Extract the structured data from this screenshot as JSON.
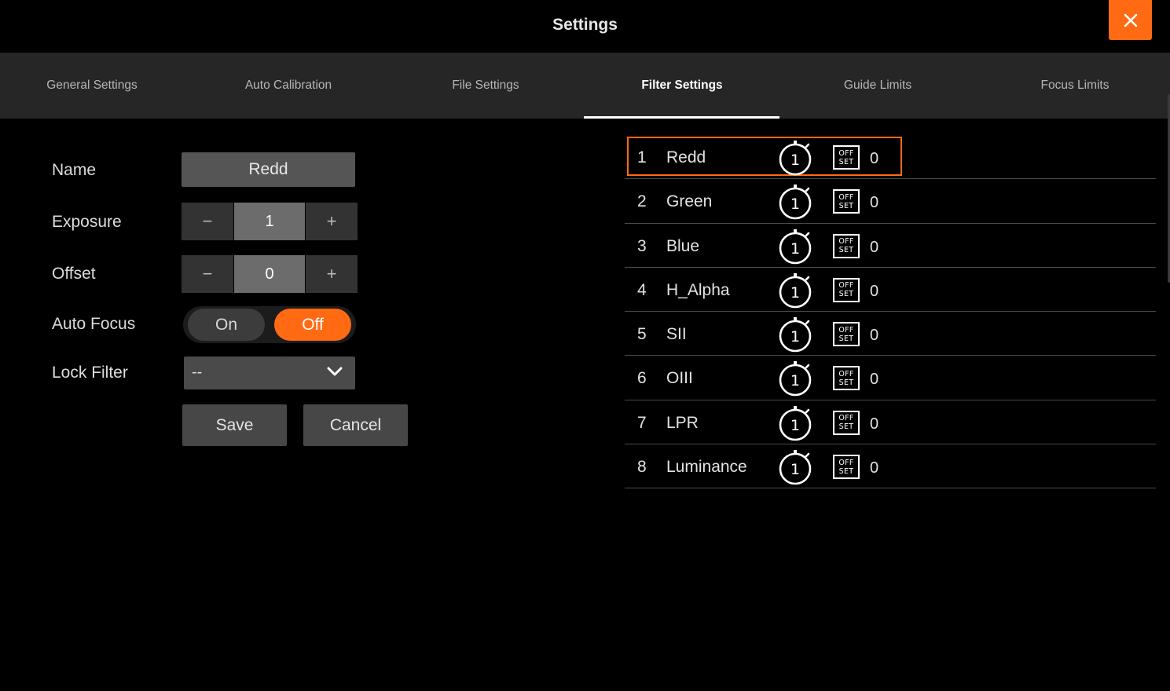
{
  "window": {
    "title": "Settings",
    "close_icon": "close-icon",
    "accent": "#ff6a13"
  },
  "tabs": [
    {
      "label": "General Settings",
      "active": false
    },
    {
      "label": "Auto Calibration",
      "active": false
    },
    {
      "label": "File Settings",
      "active": false
    },
    {
      "label": "Filter Settings",
      "active": true
    },
    {
      "label": "Guide Limits",
      "active": false
    },
    {
      "label": "Focus Limits",
      "active": false
    }
  ],
  "form": {
    "name": {
      "label": "Name",
      "value": "Redd"
    },
    "exposure": {
      "label": "Exposure",
      "value": "1",
      "minus": "−",
      "plus": "+"
    },
    "offset": {
      "label": "Offset",
      "value": "0",
      "minus": "−",
      "plus": "+"
    },
    "auto_focus": {
      "label": "Auto Focus",
      "on_label": "On",
      "off_label": "Off",
      "selected": "Off"
    },
    "lock_filter": {
      "label": "Lock Filter",
      "value": "--"
    },
    "save_label": "Save",
    "cancel_label": "Cancel"
  },
  "filters": [
    {
      "num": "1",
      "name": "Redd",
      "exposure": "1",
      "offset_icon_top": "OFF",
      "offset_icon_bottom": "SET",
      "offset": "0",
      "selected": true
    },
    {
      "num": "2",
      "name": "Green",
      "exposure": "1",
      "offset_icon_top": "OFF",
      "offset_icon_bottom": "SET",
      "offset": "0",
      "selected": false
    },
    {
      "num": "3",
      "name": "Blue",
      "exposure": "1",
      "offset_icon_top": "OFF",
      "offset_icon_bottom": "SET",
      "offset": "0",
      "selected": false
    },
    {
      "num": "4",
      "name": "H_Alpha",
      "exposure": "1",
      "offset_icon_top": "OFF",
      "offset_icon_bottom": "SET",
      "offset": "0",
      "selected": false
    },
    {
      "num": "5",
      "name": "SII",
      "exposure": "1",
      "offset_icon_top": "OFF",
      "offset_icon_bottom": "SET",
      "offset": "0",
      "selected": false
    },
    {
      "num": "6",
      "name": "OIII",
      "exposure": "1",
      "offset_icon_top": "OFF",
      "offset_icon_bottom": "SET",
      "offset": "0",
      "selected": false
    },
    {
      "num": "7",
      "name": "LPR",
      "exposure": "1",
      "offset_icon_top": "OFF",
      "offset_icon_bottom": "SET",
      "offset": "0",
      "selected": false
    },
    {
      "num": "8",
      "name": "Luminance",
      "exposure": "1",
      "offset_icon_top": "OFF",
      "offset_icon_bottom": "SET",
      "offset": "0",
      "selected": false
    }
  ]
}
